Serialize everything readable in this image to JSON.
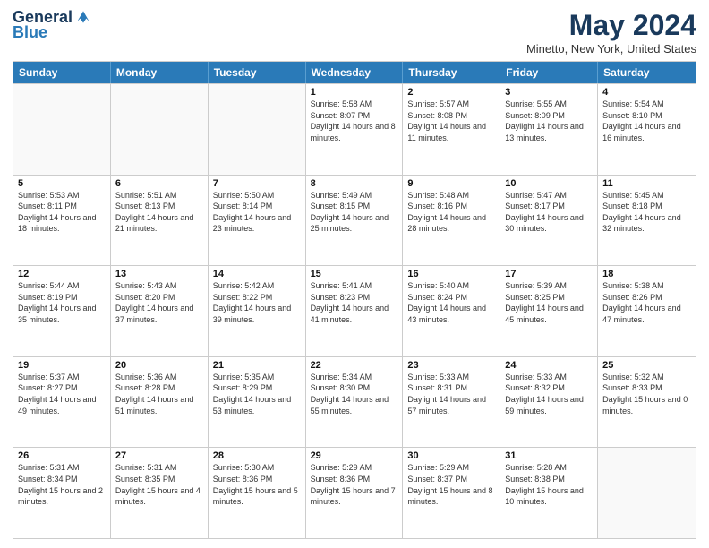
{
  "logo": {
    "line1": "General",
    "line2": "Blue"
  },
  "title": "May 2024",
  "subtitle": "Minetto, New York, United States",
  "headers": [
    "Sunday",
    "Monday",
    "Tuesday",
    "Wednesday",
    "Thursday",
    "Friday",
    "Saturday"
  ],
  "weeks": [
    [
      {
        "day": "",
        "sunrise": "",
        "sunset": "",
        "daylight": "",
        "empty": true
      },
      {
        "day": "",
        "sunrise": "",
        "sunset": "",
        "daylight": "",
        "empty": true
      },
      {
        "day": "",
        "sunrise": "",
        "sunset": "",
        "daylight": "",
        "empty": true
      },
      {
        "day": "1",
        "sunrise": "Sunrise: 5:58 AM",
        "sunset": "Sunset: 8:07 PM",
        "daylight": "Daylight: 14 hours and 8 minutes.",
        "empty": false
      },
      {
        "day": "2",
        "sunrise": "Sunrise: 5:57 AM",
        "sunset": "Sunset: 8:08 PM",
        "daylight": "Daylight: 14 hours and 11 minutes.",
        "empty": false
      },
      {
        "day": "3",
        "sunrise": "Sunrise: 5:55 AM",
        "sunset": "Sunset: 8:09 PM",
        "daylight": "Daylight: 14 hours and 13 minutes.",
        "empty": false
      },
      {
        "day": "4",
        "sunrise": "Sunrise: 5:54 AM",
        "sunset": "Sunset: 8:10 PM",
        "daylight": "Daylight: 14 hours and 16 minutes.",
        "empty": false
      }
    ],
    [
      {
        "day": "5",
        "sunrise": "Sunrise: 5:53 AM",
        "sunset": "Sunset: 8:11 PM",
        "daylight": "Daylight: 14 hours and 18 minutes.",
        "empty": false
      },
      {
        "day": "6",
        "sunrise": "Sunrise: 5:51 AM",
        "sunset": "Sunset: 8:13 PM",
        "daylight": "Daylight: 14 hours and 21 minutes.",
        "empty": false
      },
      {
        "day": "7",
        "sunrise": "Sunrise: 5:50 AM",
        "sunset": "Sunset: 8:14 PM",
        "daylight": "Daylight: 14 hours and 23 minutes.",
        "empty": false
      },
      {
        "day": "8",
        "sunrise": "Sunrise: 5:49 AM",
        "sunset": "Sunset: 8:15 PM",
        "daylight": "Daylight: 14 hours and 25 minutes.",
        "empty": false
      },
      {
        "day": "9",
        "sunrise": "Sunrise: 5:48 AM",
        "sunset": "Sunset: 8:16 PM",
        "daylight": "Daylight: 14 hours and 28 minutes.",
        "empty": false
      },
      {
        "day": "10",
        "sunrise": "Sunrise: 5:47 AM",
        "sunset": "Sunset: 8:17 PM",
        "daylight": "Daylight: 14 hours and 30 minutes.",
        "empty": false
      },
      {
        "day": "11",
        "sunrise": "Sunrise: 5:45 AM",
        "sunset": "Sunset: 8:18 PM",
        "daylight": "Daylight: 14 hours and 32 minutes.",
        "empty": false
      }
    ],
    [
      {
        "day": "12",
        "sunrise": "Sunrise: 5:44 AM",
        "sunset": "Sunset: 8:19 PM",
        "daylight": "Daylight: 14 hours and 35 minutes.",
        "empty": false
      },
      {
        "day": "13",
        "sunrise": "Sunrise: 5:43 AM",
        "sunset": "Sunset: 8:20 PM",
        "daylight": "Daylight: 14 hours and 37 minutes.",
        "empty": false
      },
      {
        "day": "14",
        "sunrise": "Sunrise: 5:42 AM",
        "sunset": "Sunset: 8:22 PM",
        "daylight": "Daylight: 14 hours and 39 minutes.",
        "empty": false
      },
      {
        "day": "15",
        "sunrise": "Sunrise: 5:41 AM",
        "sunset": "Sunset: 8:23 PM",
        "daylight": "Daylight: 14 hours and 41 minutes.",
        "empty": false
      },
      {
        "day": "16",
        "sunrise": "Sunrise: 5:40 AM",
        "sunset": "Sunset: 8:24 PM",
        "daylight": "Daylight: 14 hours and 43 minutes.",
        "empty": false
      },
      {
        "day": "17",
        "sunrise": "Sunrise: 5:39 AM",
        "sunset": "Sunset: 8:25 PM",
        "daylight": "Daylight: 14 hours and 45 minutes.",
        "empty": false
      },
      {
        "day": "18",
        "sunrise": "Sunrise: 5:38 AM",
        "sunset": "Sunset: 8:26 PM",
        "daylight": "Daylight: 14 hours and 47 minutes.",
        "empty": false
      }
    ],
    [
      {
        "day": "19",
        "sunrise": "Sunrise: 5:37 AM",
        "sunset": "Sunset: 8:27 PM",
        "daylight": "Daylight: 14 hours and 49 minutes.",
        "empty": false
      },
      {
        "day": "20",
        "sunrise": "Sunrise: 5:36 AM",
        "sunset": "Sunset: 8:28 PM",
        "daylight": "Daylight: 14 hours and 51 minutes.",
        "empty": false
      },
      {
        "day": "21",
        "sunrise": "Sunrise: 5:35 AM",
        "sunset": "Sunset: 8:29 PM",
        "daylight": "Daylight: 14 hours and 53 minutes.",
        "empty": false
      },
      {
        "day": "22",
        "sunrise": "Sunrise: 5:34 AM",
        "sunset": "Sunset: 8:30 PM",
        "daylight": "Daylight: 14 hours and 55 minutes.",
        "empty": false
      },
      {
        "day": "23",
        "sunrise": "Sunrise: 5:33 AM",
        "sunset": "Sunset: 8:31 PM",
        "daylight": "Daylight: 14 hours and 57 minutes.",
        "empty": false
      },
      {
        "day": "24",
        "sunrise": "Sunrise: 5:33 AM",
        "sunset": "Sunset: 8:32 PM",
        "daylight": "Daylight: 14 hours and 59 minutes.",
        "empty": false
      },
      {
        "day": "25",
        "sunrise": "Sunrise: 5:32 AM",
        "sunset": "Sunset: 8:33 PM",
        "daylight": "Daylight: 15 hours and 0 minutes.",
        "empty": false
      }
    ],
    [
      {
        "day": "26",
        "sunrise": "Sunrise: 5:31 AM",
        "sunset": "Sunset: 8:34 PM",
        "daylight": "Daylight: 15 hours and 2 minutes.",
        "empty": false
      },
      {
        "day": "27",
        "sunrise": "Sunrise: 5:31 AM",
        "sunset": "Sunset: 8:35 PM",
        "daylight": "Daylight: 15 hours and 4 minutes.",
        "empty": false
      },
      {
        "day": "28",
        "sunrise": "Sunrise: 5:30 AM",
        "sunset": "Sunset: 8:36 PM",
        "daylight": "Daylight: 15 hours and 5 minutes.",
        "empty": false
      },
      {
        "day": "29",
        "sunrise": "Sunrise: 5:29 AM",
        "sunset": "Sunset: 8:36 PM",
        "daylight": "Daylight: 15 hours and 7 minutes.",
        "empty": false
      },
      {
        "day": "30",
        "sunrise": "Sunrise: 5:29 AM",
        "sunset": "Sunset: 8:37 PM",
        "daylight": "Daylight: 15 hours and 8 minutes.",
        "empty": false
      },
      {
        "day": "31",
        "sunrise": "Sunrise: 5:28 AM",
        "sunset": "Sunset: 8:38 PM",
        "daylight": "Daylight: 15 hours and 10 minutes.",
        "empty": false
      },
      {
        "day": "",
        "sunrise": "",
        "sunset": "",
        "daylight": "",
        "empty": true
      }
    ]
  ]
}
